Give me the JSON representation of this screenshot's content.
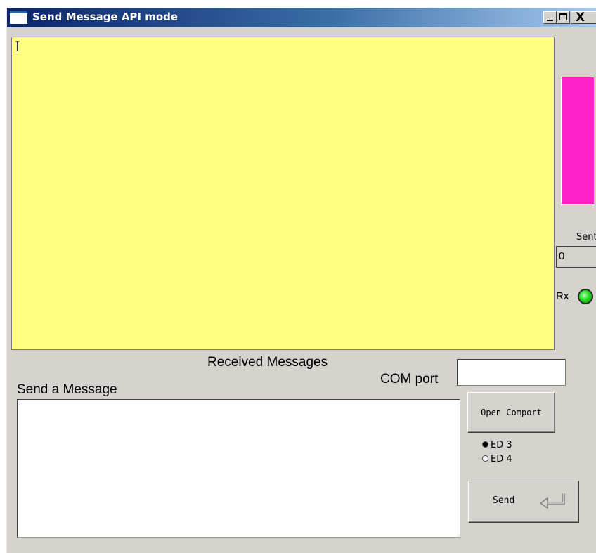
{
  "window": {
    "title": "Send Message API mode",
    "controls": {
      "minimize": "_",
      "maximize": "□",
      "close": "X"
    }
  },
  "received": {
    "label": "Received Messages",
    "content": "",
    "background_color": "#ffff80"
  },
  "status": {
    "bar_color": "#ff22c8",
    "sent_label": "Sent",
    "sent_value": "0",
    "rx_label": "Rx",
    "rx_led_color": "#22dd22"
  },
  "com": {
    "label": "COM port",
    "value": "",
    "open_button_label": "Open Comport"
  },
  "send": {
    "label": "Send a Message",
    "message_value": "",
    "button_label": "Send",
    "button_icon": "enter-arrow-icon"
  },
  "device": {
    "options": [
      "ED 3",
      "ED 4"
    ],
    "selected": "ED 3"
  }
}
